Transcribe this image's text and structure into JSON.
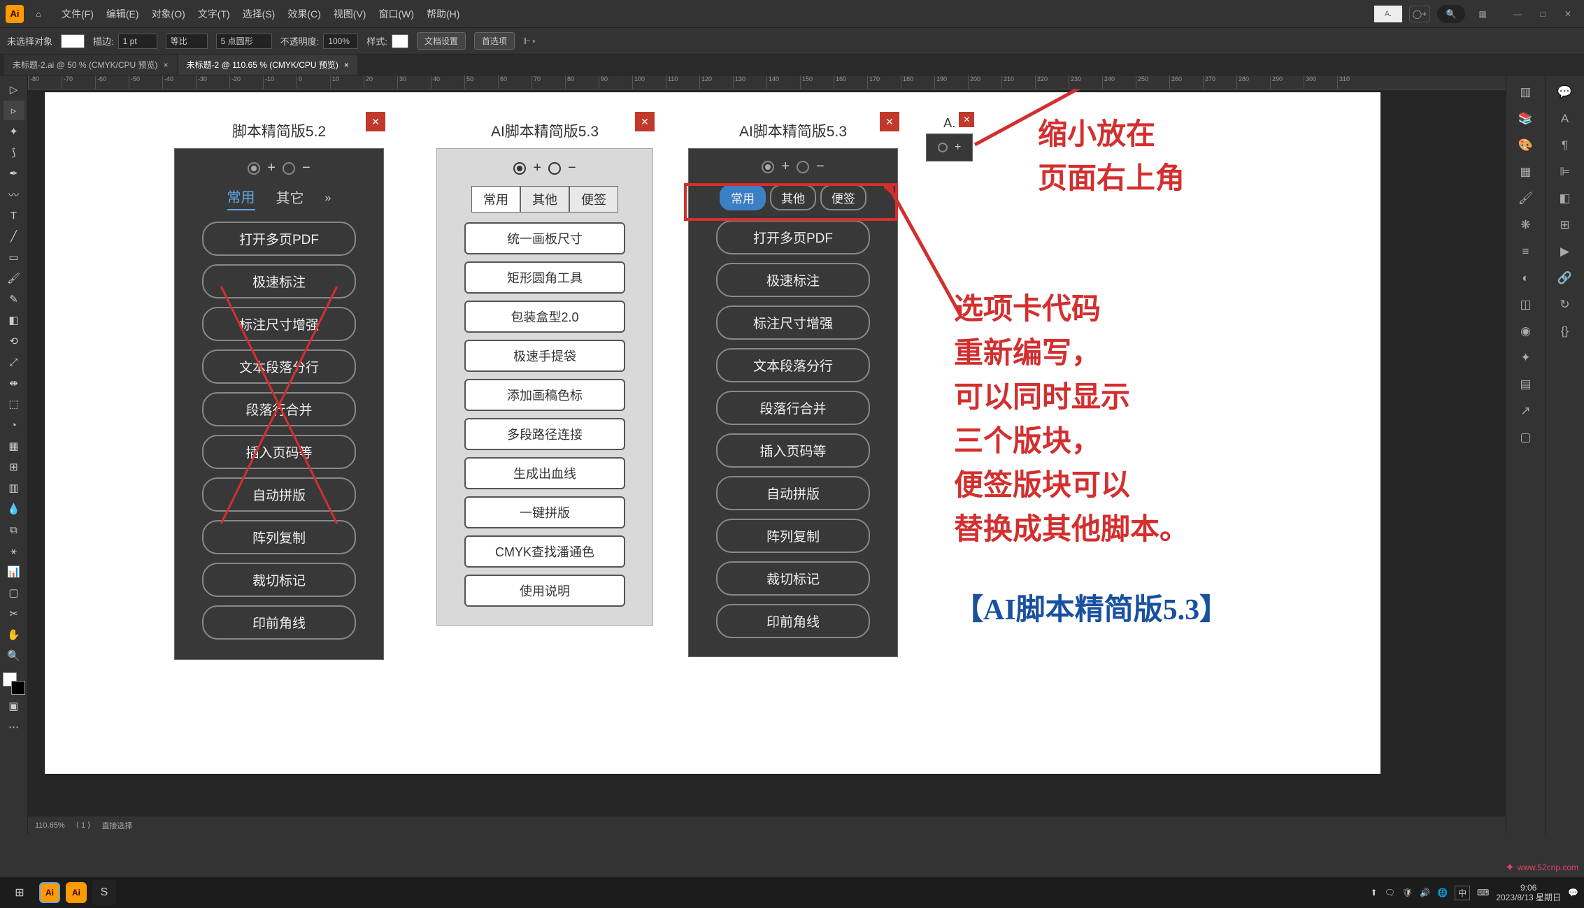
{
  "menu": {
    "file": "文件(F)",
    "edit": "编辑(E)",
    "object": "对象(O)",
    "text": "文字(T)",
    "select": "选择(S)",
    "effect": "效果(C)",
    "view": "视图(V)",
    "window": "窗口(W)",
    "help": "帮助(H)"
  },
  "mini_label": "A.",
  "ctrlbar": {
    "noselect": "未选择对象",
    "stroke": "描边:",
    "stroke_val": "1 pt",
    "uniform": "等比",
    "point": "5 点圆形",
    "opacity": "不透明度:",
    "opacity_val": "100%",
    "style": "样式:",
    "docset": "文档设置",
    "prefs": "首选项"
  },
  "tabs": {
    "t1": "未标题-2.ai @ 50 % (CMYK/CPU 预览)",
    "t2": "未标题-2 @ 110.65 % (CMYK/CPU 预览)"
  },
  "ruler_marks": [
    -80,
    -70,
    -60,
    -50,
    -40,
    -30,
    -20,
    -10,
    0,
    10,
    20,
    30,
    40,
    50,
    60,
    70,
    80,
    90,
    100,
    110,
    120,
    130,
    140,
    150,
    160,
    170,
    180,
    190,
    200,
    210,
    220,
    230,
    240,
    250,
    260,
    270,
    280,
    290,
    300,
    310
  ],
  "panel52": {
    "title": "脚本精简版5.2",
    "tabs": {
      "a": "常用",
      "b": "其它"
    },
    "buttons": [
      "打开多页PDF",
      "极速标注",
      "标注尺寸增强",
      "文本段落分行",
      "段落行合并",
      "插入页码等",
      "自动拼版",
      "阵列复制",
      "裁切标记",
      "印前角线"
    ]
  },
  "panel53w": {
    "title": "AI脚本精简版5.3",
    "tabs": {
      "a": "常用",
      "b": "其他",
      "c": "便签"
    },
    "buttons": [
      "统一画板尺寸",
      "矩形圆角工具",
      "包装盒型2.0",
      "极速手提袋",
      "添加画稿色标",
      "多段路径连接",
      "生成出血线",
      "一键拼版",
      "CMYK查找潘通色",
      "使用说明"
    ]
  },
  "panel53d": {
    "title": "AI脚本精简版5.3",
    "tabs": {
      "a": "常用",
      "b": "其他",
      "c": "便签"
    },
    "buttons": [
      "打开多页PDF",
      "极速标注",
      "标注尺寸增强",
      "文本段落分行",
      "段落行合并",
      "插入页码等",
      "自动拼版",
      "阵列复制",
      "裁切标记",
      "印前角线"
    ]
  },
  "mini_panel": {
    "title": "A."
  },
  "annots": {
    "top1": "缩小放在",
    "top2": "页面右上角",
    "mid1": "选项卡代码",
    "mid2": "重新编写，",
    "mid3": "可以同时显示",
    "mid4": "三个版块，",
    "mid5": "便签版块可以",
    "mid6": "替换成其他脚本。",
    "bottom": "【AI脚本精简版5.3】"
  },
  "status": {
    "zoom": "110.65%",
    "tool": "直接选择"
  },
  "taskbar": {
    "time": "9:06",
    "date": "2023/8/13 星期日",
    "ime": "中"
  },
  "watermark": "www.52cnp.com"
}
